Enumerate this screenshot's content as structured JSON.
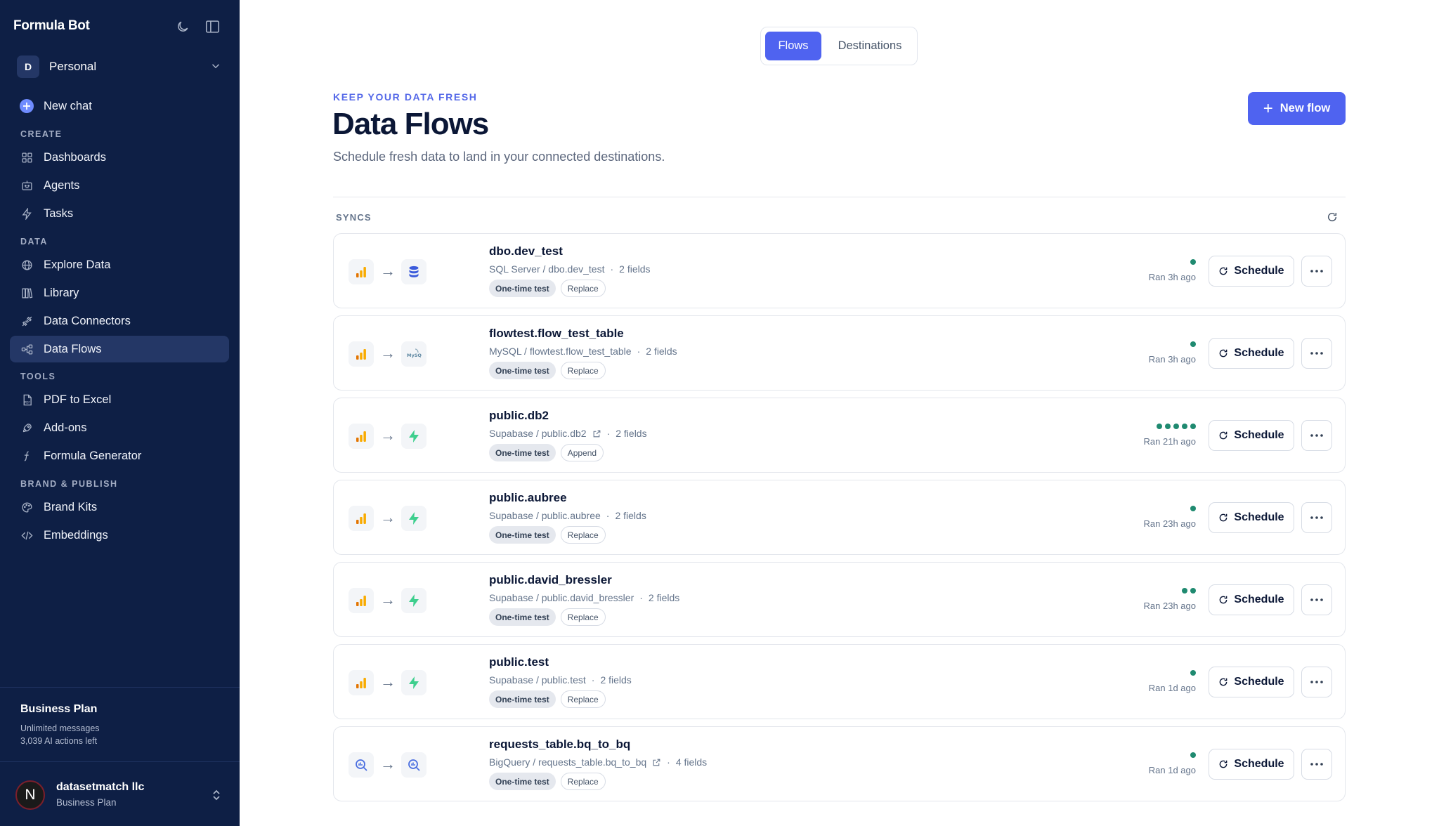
{
  "sidebar": {
    "brand": "Formula Bot",
    "workspace": {
      "initial": "D",
      "name": "Personal"
    },
    "new_chat": "New chat",
    "sections": {
      "create": "CREATE",
      "data": "DATA",
      "tools": "TOOLS",
      "brand": "BRAND & PUBLISH"
    },
    "items": {
      "dashboards": "Dashboards",
      "agents": "Agents",
      "tasks": "Tasks",
      "explore": "Explore Data",
      "library": "Library",
      "connectors": "Data Connectors",
      "flows": "Data Flows",
      "pdf": "PDF to Excel",
      "addons": "Add-ons",
      "formula": "Formula Generator",
      "brandkits": "Brand Kits",
      "embeddings": "Embeddings"
    },
    "plan": {
      "title": "Business Plan",
      "line1": "Unlimited messages",
      "line2": "3,039 AI actions left"
    },
    "account": {
      "initial": "N",
      "name": "datasetmatch llc",
      "plan": "Business Plan"
    }
  },
  "tabs": {
    "flows": "Flows",
    "destinations": "Destinations",
    "active": "Flows"
  },
  "header": {
    "eyebrow": "KEEP YOUR DATA FRESH",
    "title": "Data Flows",
    "subtitle": "Schedule fresh data to land in your connected destinations.",
    "new_flow": "New flow"
  },
  "syncs_label": "SYNCS",
  "schedule_label": "Schedule",
  "flows": [
    {
      "name": "dbo.dev_test",
      "source": "SQL Server / dbo.dev_test",
      "fields": "2 fields",
      "test": "One-time test",
      "mode": "Replace",
      "dots": 1,
      "ran": "Ran 3h ago"
    },
    {
      "name": "flowtest.flow_test_table",
      "source": "MySQL / flowtest.flow_test_table",
      "fields": "2 fields",
      "test": "One-time test",
      "mode": "Replace",
      "dots": 1,
      "ran": "Ran 3h ago"
    },
    {
      "name": "public.db2",
      "source": "Supabase / public.db2",
      "fields": "2 fields",
      "test": "One-time test",
      "mode": "Append",
      "dots": 5,
      "ran": "Ran 21h ago"
    },
    {
      "name": "public.aubree",
      "source": "Supabase / public.aubree",
      "fields": "2 fields",
      "test": "One-time test",
      "mode": "Replace",
      "dots": 1,
      "ran": "Ran 23h ago"
    },
    {
      "name": "public.david_bressler",
      "source": "Supabase / public.david_bressler",
      "fields": "2 fields",
      "test": "One-time test",
      "mode": "Replace",
      "dots": 2,
      "ran": "Ran 23h ago"
    },
    {
      "name": "public.test",
      "source": "Supabase / public.test",
      "fields": "2 fields",
      "test": "One-time test",
      "mode": "Replace",
      "dots": 1,
      "ran": "Ran 1d ago"
    },
    {
      "name": "requests_table.bq_to_bq",
      "source": "BigQuery / requests_table.bq_to_bq",
      "fields": "4 fields",
      "test": "One-time test",
      "mode": "Replace",
      "dots": 1,
      "ran": "Ran 1d ago"
    }
  ],
  "colors": {
    "sidebar_bg": "#0e1f45",
    "accent": "#4f63f0",
    "status_dot": "#1f8a70",
    "analytics_orange": "#f9ab00"
  }
}
